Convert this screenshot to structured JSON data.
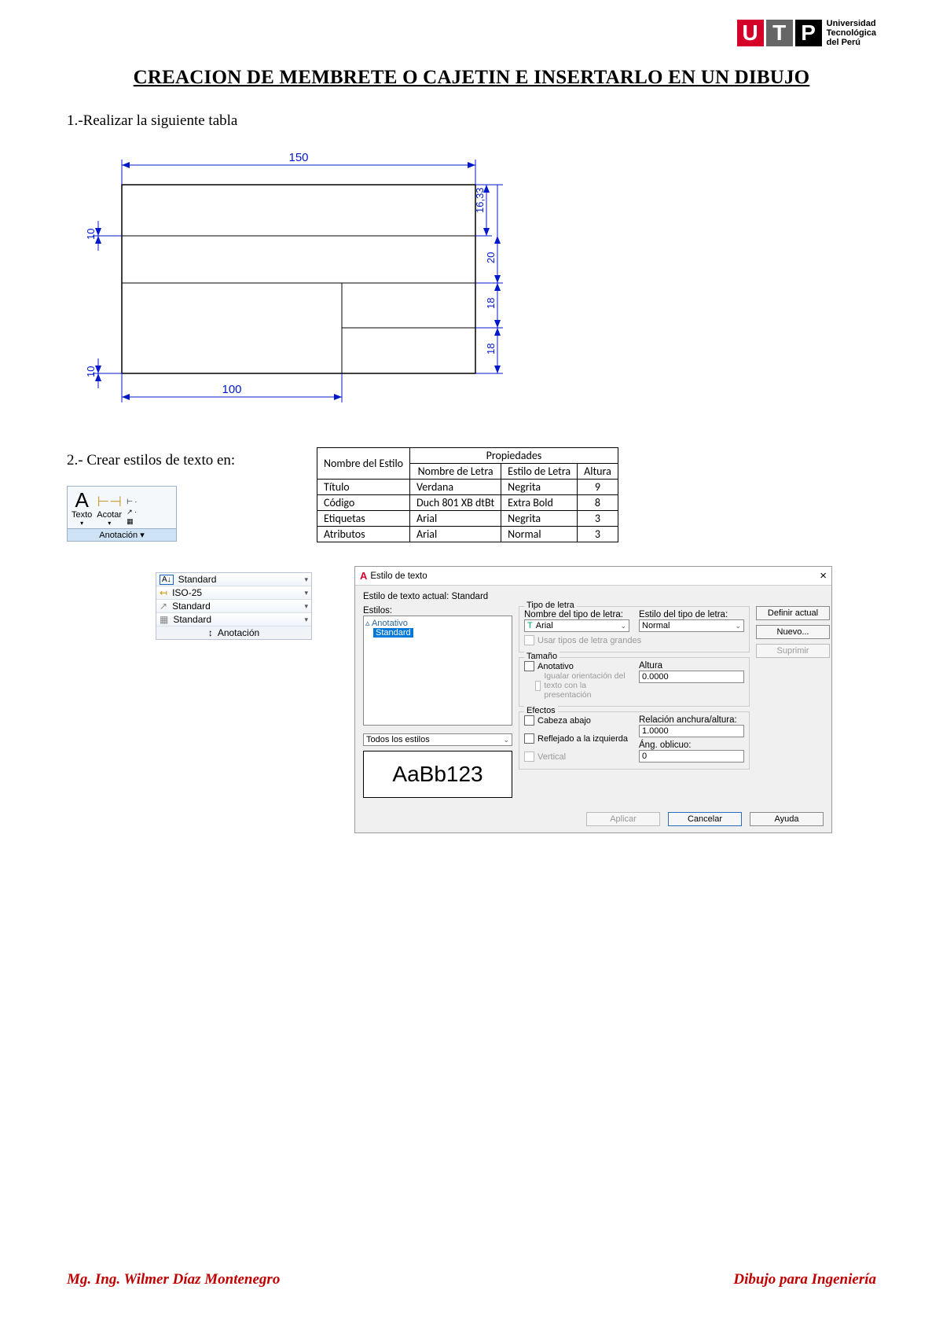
{
  "logo": {
    "l1": "U",
    "l2": "T",
    "l3": "P",
    "sub1": "Universidad",
    "sub2": "Tecnológica",
    "sub3": "del Perú"
  },
  "title": "CREACION DE MEMBRETE O CAJETIN E INSERTARLO EN UN DIBUJO",
  "step1": "1.-Realizar la siguiente tabla",
  "step2": "2.- Crear estilos de texto en:",
  "diagram": {
    "top": "150",
    "bottom": "100",
    "d1": "16,33",
    "d2": "20",
    "d3": "18",
    "d4": "18",
    "left1": "10",
    "left2": "10"
  },
  "ribbon": {
    "texto": "Texto",
    "acotar": "Acotar",
    "panel": "Anotación ▾"
  },
  "annoList": {
    "r1": "Standard",
    "r2": "ISO-25",
    "r3": "Standard",
    "r4": "Standard",
    "r5": "Anotación"
  },
  "styleTable": {
    "h1": "Nombre del Estilo",
    "h2": "Propiedades",
    "h2a": "Nombre de Letra",
    "h2b": "Estilo de Letra",
    "h2c": "Altura",
    "rows": [
      {
        "a": "Título",
        "b": "Verdana",
        "c": "Negrita",
        "d": "9"
      },
      {
        "a": "Código",
        "b": "Duch 801 XB dtBt",
        "c": "Extra Bold",
        "d": "8"
      },
      {
        "a": "Etiquetas",
        "b": "Arial",
        "c": "Negrita",
        "d": "3"
      },
      {
        "a": "Atributos",
        "b": "Arial",
        "c": "Normal",
        "d": "3"
      }
    ]
  },
  "dlg": {
    "title": "Estilo de texto",
    "current": "Estilo de texto actual:  Standard",
    "estilos": "Estilos:",
    "li1": "▵ Anotativo",
    "li2": "Standard",
    "filter": "Todos los estilos",
    "preview": "AaBb123",
    "tipo": "Tipo de letra",
    "nombreTipo": "Nombre del tipo de letra:",
    "estiloTipo": "Estilo del tipo de letra:",
    "arial": "Arial",
    "normal": "Normal",
    "usar": "Usar tipos de letra grandes",
    "tam": "Tamaño",
    "anot": "Anotativo",
    "igualar": "Igualar orientación del texto con la presentación",
    "altura": "Altura",
    "alturaV": "0.0000",
    "ef": "Efectos",
    "cabeza": "Cabeza abajo",
    "refl": "Reflejado a la izquierda",
    "vert": "Vertical",
    "rel": "Relación anchura/altura:",
    "relV": "1.0000",
    "ang": "Áng. oblicuo:",
    "angV": "0",
    "definir": "Definir actual",
    "nuevo": "Nuevo...",
    "suprimir": "Suprimir",
    "aplicar": "Aplicar",
    "cancelar": "Cancelar",
    "ayuda": "Ayuda"
  },
  "footer": {
    "left": "Mg. Ing. Wilmer Díaz Montenegro",
    "right": "Dibujo para Ingeniería"
  }
}
